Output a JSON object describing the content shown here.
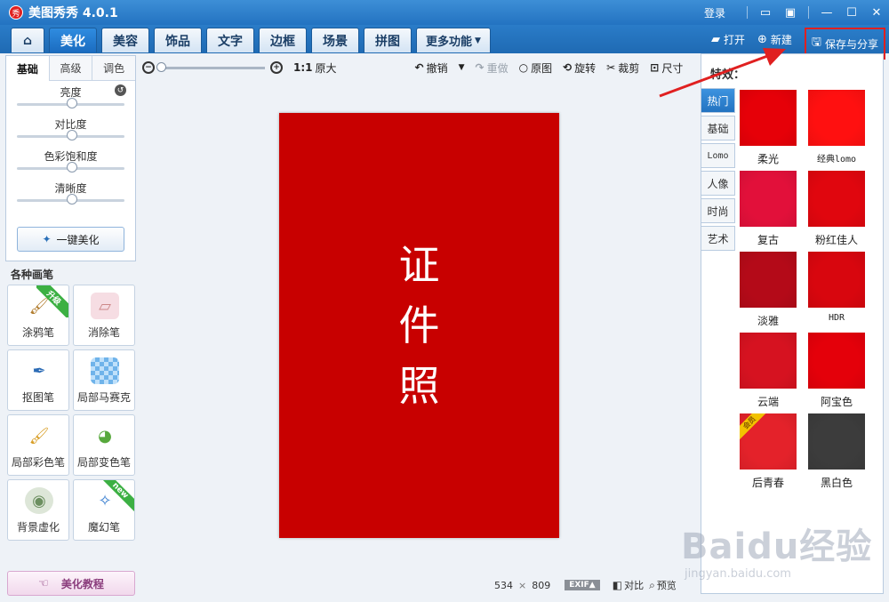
{
  "app": {
    "title": "美图秀秀 4.0.1",
    "logo_text": "秀",
    "login": "登录"
  },
  "window_icons": [
    "message-icon",
    "skin-icon",
    "minimize-icon",
    "maximize-icon",
    "close-icon"
  ],
  "tabs": [
    {
      "id": "home",
      "label": ""
    },
    {
      "id": "beautify",
      "label": "美化",
      "active": true
    },
    {
      "id": "face",
      "label": "美容"
    },
    {
      "id": "decor",
      "label": "饰品"
    },
    {
      "id": "text",
      "label": "文字"
    },
    {
      "id": "frame",
      "label": "边框"
    },
    {
      "id": "scene",
      "label": "场景"
    },
    {
      "id": "collage",
      "label": "拼图"
    },
    {
      "id": "more",
      "label": "更多功能"
    }
  ],
  "actions": {
    "open": "打开",
    "new": "新建",
    "save": "保存与分享"
  },
  "left": {
    "subtabs": [
      "基础",
      "高级",
      "调色"
    ],
    "sliders": [
      {
        "label": "亮度",
        "value": 0.5
      },
      {
        "label": "对比度",
        "value": 0.5
      },
      {
        "label": "色彩饱和度",
        "value": 0.5
      },
      {
        "label": "清晰度",
        "value": 0.5
      }
    ],
    "one_click": "一键美化",
    "brushes_title": "各种画笔",
    "brushes": [
      {
        "name": "brush-graffiti",
        "label": "涂鸦笔",
        "badge": "升级"
      },
      {
        "name": "brush-eraser",
        "label": "消除笔",
        "badge": ""
      },
      {
        "name": "brush-cutout",
        "label": "抠图笔",
        "badge": ""
      },
      {
        "name": "brush-mosaic",
        "label": "局部马赛克",
        "badge": ""
      },
      {
        "name": "brush-color",
        "label": "局部彩色笔",
        "badge": ""
      },
      {
        "name": "brush-recolor",
        "label": "局部变色笔",
        "badge": ""
      },
      {
        "name": "brush-blur",
        "label": "背景虚化",
        "badge": ""
      },
      {
        "name": "brush-magic",
        "label": "魔幻笔",
        "badge": "new"
      }
    ],
    "tutorial": "美化教程"
  },
  "toolbar": {
    "zoom_level": 0,
    "ratio_label": "1:1",
    "original_size": "原大",
    "undo": "撤销",
    "redo": "重做",
    "original": "原图",
    "rotate": "旋转",
    "crop": "裁剪",
    "size": "尺寸"
  },
  "canvas": {
    "photo_text": "证件照",
    "photo_color": "#c80000"
  },
  "status": {
    "width": "534",
    "times": "×",
    "height": "809",
    "exif": "EXIF▲",
    "compare": "对比",
    "preview": "预览"
  },
  "effects": {
    "title": "特效",
    "categories": [
      {
        "label": "热门",
        "active": true
      },
      {
        "label": "基础"
      },
      {
        "label": "Lomo"
      },
      {
        "label": "人像"
      },
      {
        "label": "时尚"
      },
      {
        "label": "艺术"
      }
    ],
    "items": [
      {
        "label": "柔光",
        "color": "#e60008"
      },
      {
        "label": "经典lomo",
        "color": "#ff1010"
      },
      {
        "label": "复古",
        "color": "#e2103a"
      },
      {
        "label": "粉红佳人",
        "color": "#e0060e"
      },
      {
        "label": "淡雅",
        "color": "#b40a18"
      },
      {
        "label": "HDR",
        "color": "#d8060e"
      },
      {
        "label": "云端",
        "color": "#d61220"
      },
      {
        "label": "阿宝色",
        "color": "#e4000a"
      },
      {
        "label": "后青春",
        "color": "#e4222a",
        "corner": "会员"
      },
      {
        "label": "黑白色",
        "color": "#3c3c3c"
      }
    ]
  },
  "watermark": {
    "main": "Baidu经验",
    "sub": "jingyan.baidu.com"
  },
  "colors": {
    "accent_blue": "#2373c1",
    "highlight_red": "#e02020"
  }
}
